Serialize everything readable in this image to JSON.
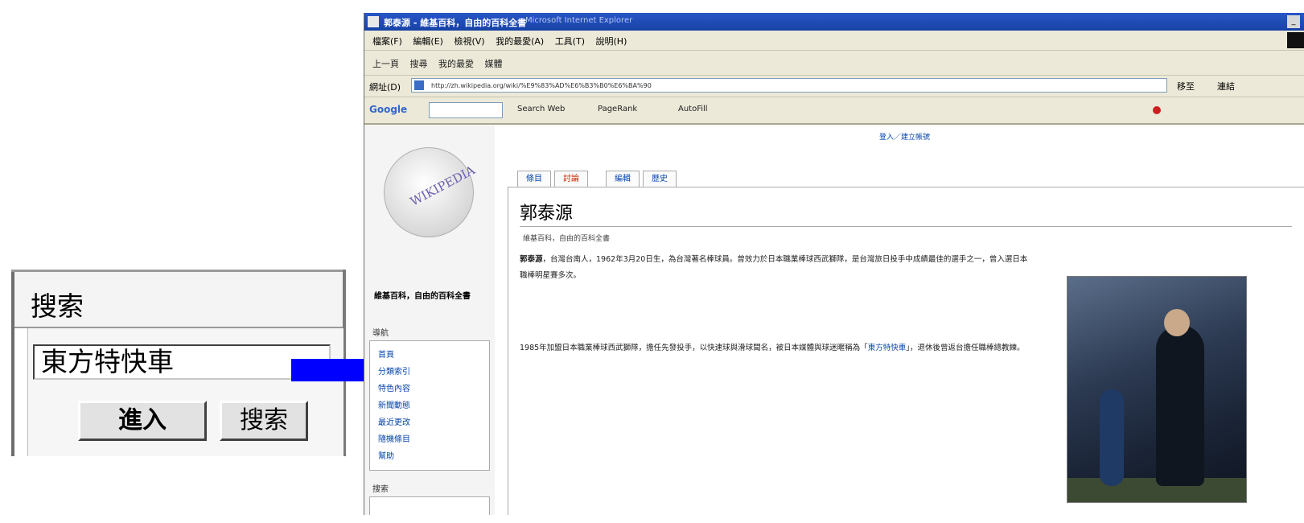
{
  "zoom_panel": {
    "header": "搜索",
    "input_value": "東方特快車",
    "go_button": "進入",
    "search_button": "搜索"
  },
  "browser": {
    "title": "郭泰源 - 維基百科，自由的百科全書",
    "title_app": "Microsoft Internet Explorer",
    "menu": [
      "檔案(F)",
      "編輯(E)",
      "檢視(V)",
      "我的最愛(A)",
      "工具(T)",
      "說明(H)"
    ],
    "toolbar": [
      "上一頁",
      "搜尋",
      "我的最愛",
      "媒體"
    ],
    "address_label": "網址(D)",
    "address_url": "http://zh.wikipedia.org/wiki/%E9%83%AD%E6%B3%B0%E6%BA%90",
    "go_label": "移至",
    "links_label": "連結",
    "google": {
      "logo": "Google",
      "items": [
        "Search Web",
        "PageRank",
        "AutoFill"
      ]
    },
    "personal_links": "登入／建立帳號",
    "tabs": [
      "條目",
      "討論",
      "編輯",
      "歷史"
    ],
    "page_title": "郭泰源",
    "subtitle": "維基百科，自由的百科全書",
    "lead_bold": "郭泰源",
    "paragraphs": [
      "，台灣台南人，1962年3月20日生，為台灣著名棒球員。曾效力於日本職業棒球西武獅隊，是台灣旅日投手中成績最佳的選手之一，曾入選日本職棒明星賽多次。",
      "1985年加盟日本職業棒球西武獅隊，擔任先發投手，以快速球與滑球聞名，被日本媒體與球迷暱稱為「",
      "」，退休後曾返台擔任職棒總教練。"
    ],
    "link_text": "東方特快車",
    "sidebar": {
      "logo_text": "WIKIPEDIA",
      "site_name": "維基百科，自由的百科全書",
      "nav_header": "導航",
      "nav_items": [
        "首頁",
        "分類索引",
        "特色內容",
        "新聞動態",
        "最近更改",
        "隨機條目",
        "幫助"
      ],
      "search_header": "搜索"
    }
  }
}
